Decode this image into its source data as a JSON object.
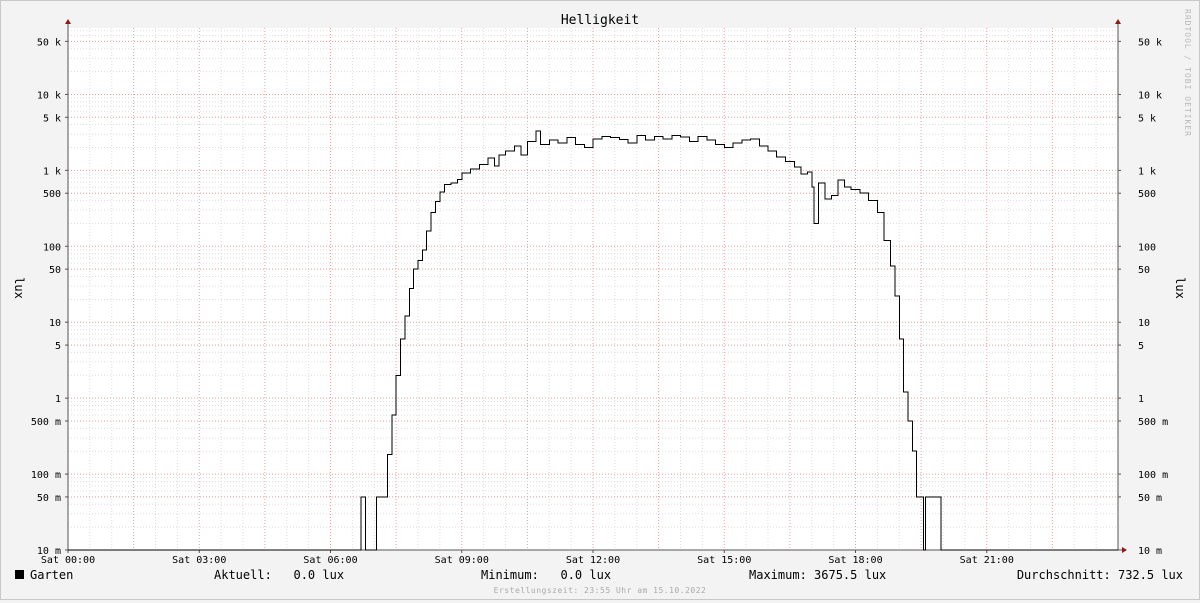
{
  "chart_data": {
    "type": "line",
    "title": "Helligkeit",
    "ylabel": "lux",
    "yscale": "log",
    "ylim": [
      0.01,
      75000
    ],
    "xlim_hours": [
      0,
      24
    ],
    "grid": true,
    "x_ticks": [
      {
        "hour": 0,
        "label": "Sat 00:00"
      },
      {
        "hour": 3,
        "label": "Sat 03:00"
      },
      {
        "hour": 6,
        "label": "Sat 06:00"
      },
      {
        "hour": 9,
        "label": "Sat 09:00"
      },
      {
        "hour": 12,
        "label": "Sat 12:00"
      },
      {
        "hour": 15,
        "label": "Sat 15:00"
      },
      {
        "hour": 18,
        "label": "Sat 18:00"
      },
      {
        "hour": 21,
        "label": "Sat 21:00"
      }
    ],
    "y_ticks": [
      {
        "value": 0.01,
        "label": "10 m"
      },
      {
        "value": 0.05,
        "label": "50 m"
      },
      {
        "value": 0.1,
        "label": "100 m"
      },
      {
        "value": 0.5,
        "label": "500 m"
      },
      {
        "value": 1,
        "label": "1"
      },
      {
        "value": 5,
        "label": "5"
      },
      {
        "value": 10,
        "label": "10"
      },
      {
        "value": 50,
        "label": "50"
      },
      {
        "value": 100,
        "label": "100"
      },
      {
        "value": 500,
        "label": "500"
      },
      {
        "value": 1000,
        "label": "1 k"
      },
      {
        "value": 5000,
        "label": "5 k"
      },
      {
        "value": 10000,
        "label": "10 k"
      },
      {
        "value": 50000,
        "label": "50 k"
      }
    ],
    "series": [
      {
        "name": "Garten",
        "color": "#000000",
        "points": [
          [
            0,
            0.01
          ],
          [
            6.67,
            0.01
          ],
          [
            6.7,
            0.05
          ],
          [
            6.75,
            0.05
          ],
          [
            6.8,
            0.01
          ],
          [
            7.0,
            0.01
          ],
          [
            7.05,
            0.05
          ],
          [
            7.2,
            0.05
          ],
          [
            7.3,
            0.18
          ],
          [
            7.4,
            0.6
          ],
          [
            7.5,
            2
          ],
          [
            7.6,
            6
          ],
          [
            7.7,
            12
          ],
          [
            7.8,
            28
          ],
          [
            7.9,
            50
          ],
          [
            8.0,
            65
          ],
          [
            8.1,
            90
          ],
          [
            8.2,
            160
          ],
          [
            8.3,
            280
          ],
          [
            8.4,
            390
          ],
          [
            8.5,
            520
          ],
          [
            8.6,
            650
          ],
          [
            8.75,
            680
          ],
          [
            8.9,
            760
          ],
          [
            9.0,
            920
          ],
          [
            9.2,
            1050
          ],
          [
            9.4,
            1200
          ],
          [
            9.6,
            1450
          ],
          [
            9.75,
            1150
          ],
          [
            9.85,
            1600
          ],
          [
            10.0,
            1800
          ],
          [
            10.2,
            2100
          ],
          [
            10.35,
            1600
          ],
          [
            10.5,
            2400
          ],
          [
            10.7,
            3300
          ],
          [
            10.8,
            2200
          ],
          [
            11.0,
            2500
          ],
          [
            11.2,
            2300
          ],
          [
            11.4,
            2700
          ],
          [
            11.6,
            2200
          ],
          [
            11.8,
            2000
          ],
          [
            12.0,
            2600
          ],
          [
            12.2,
            2800
          ],
          [
            12.4,
            2700
          ],
          [
            12.6,
            2550
          ],
          [
            12.8,
            2300
          ],
          [
            13.0,
            2900
          ],
          [
            13.2,
            2500
          ],
          [
            13.4,
            2800
          ],
          [
            13.6,
            2600
          ],
          [
            13.8,
            2900
          ],
          [
            14.0,
            2750
          ],
          [
            14.2,
            2400
          ],
          [
            14.4,
            2800
          ],
          [
            14.6,
            2500
          ],
          [
            14.8,
            2200
          ],
          [
            15.0,
            2000
          ],
          [
            15.2,
            2300
          ],
          [
            15.4,
            2500
          ],
          [
            15.6,
            2600
          ],
          [
            15.8,
            2100
          ],
          [
            16.0,
            1800
          ],
          [
            16.2,
            1500
          ],
          [
            16.4,
            1300
          ],
          [
            16.6,
            1100
          ],
          [
            16.75,
            900
          ],
          [
            16.9,
            950
          ],
          [
            17.0,
            600
          ],
          [
            17.05,
            200
          ],
          [
            17.15,
            680
          ],
          [
            17.3,
            420
          ],
          [
            17.45,
            470
          ],
          [
            17.6,
            750
          ],
          [
            17.75,
            600
          ],
          [
            17.9,
            560
          ],
          [
            18.1,
            500
          ],
          [
            18.3,
            400
          ],
          [
            18.5,
            280
          ],
          [
            18.65,
            120
          ],
          [
            18.8,
            55
          ],
          [
            18.9,
            22
          ],
          [
            19.0,
            6
          ],
          [
            19.1,
            1.2
          ],
          [
            19.2,
            0.5
          ],
          [
            19.3,
            0.2
          ],
          [
            19.4,
            0.05
          ],
          [
            19.55,
            0.01
          ],
          [
            19.6,
            0.05
          ],
          [
            19.9,
            0.05
          ],
          [
            19.95,
            0.01
          ],
          [
            24,
            0.01
          ]
        ]
      }
    ],
    "legend": {
      "series_name": "Garten",
      "current": "Aktuell:   0.0 lux",
      "minimum": "Minimum:   0.0 lux",
      "maximum": "Maximum: 3675.5 lux",
      "average": "Durchschnitt: 732.5 lux"
    },
    "watermark": "RRDTOOL / TOBI OETIKER",
    "footer": "Erstellungszeit: 23:55 Uhr am 15.10.2022"
  }
}
